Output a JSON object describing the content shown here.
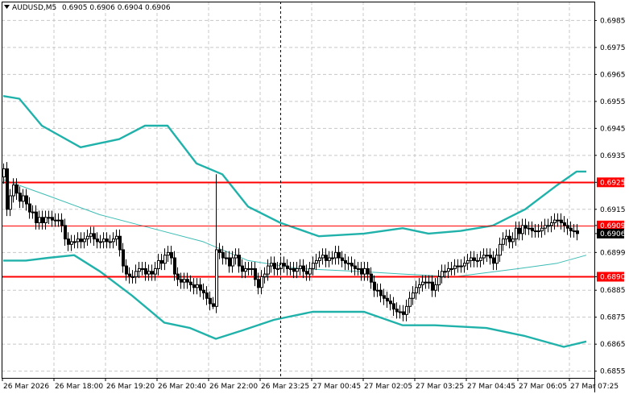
{
  "header": {
    "symbol": "AUDUSD,M5",
    "ohlc": "0.6905 0.6906 0.6904 0.6906",
    "dropdown_icon": "triangle-down-icon"
  },
  "colors": {
    "background": "#ffffff",
    "grid": "#c8c8c8",
    "candle": "#000000",
    "bands": "#20b2aa",
    "middle_band": "#3cbcb4",
    "level_line": "#ff0000",
    "level_label_bg": "#ff0000",
    "current_label_bg": "#000000",
    "current_label_text": "#ffffff"
  },
  "chart_data": {
    "type": "candlestick",
    "symbol": "AUDUSD",
    "timeframe": "M5",
    "ylim": [
      0.68525,
      0.6992
    ],
    "y_ticks": [
      "0.6985",
      "0.6975",
      "0.6965",
      "0.6955",
      "0.6945",
      "0.6935",
      "0.6925",
      "0.6915",
      "0.6909",
      "0.6906",
      "0.6899",
      "0.6890",
      "0.6885",
      "0.6875",
      "0.6865",
      "0.6855"
    ],
    "x_labels": [
      "26 Mar 2026",
      "26 Mar 18:00",
      "26 Mar 19:20",
      "26 Mar 20:40",
      "26 Mar 22:00",
      "26 Mar 23:25",
      "27 Mar 00:45",
      "27 Mar 02:05",
      "27 Mar 03:25",
      "27 Mar 04:45",
      "27 Mar 06:05",
      "27 Mar 07:25"
    ],
    "bars_per_label": 16,
    "cursor_bar_index": 86,
    "grid": true,
    "levels": [
      {
        "price": 0.6925,
        "label": "0.6925",
        "style": "thick"
      },
      {
        "price": 0.6909,
        "label": "0.6909",
        "style": "thin"
      },
      {
        "price": 0.689,
        "label": "0.6890",
        "style": "thick"
      }
    ],
    "current_price": {
      "price": 0.6906,
      "label": "0.6906"
    },
    "closes": [
      0.693,
      0.6915,
      0.692,
      0.6924,
      0.6921,
      0.6918,
      0.692,
      0.6917,
      0.6914,
      0.6914,
      0.691,
      0.6912,
      0.691,
      0.6912,
      0.6912,
      0.6911,
      0.6911,
      0.6911,
      0.6909,
      0.6904,
      0.6902,
      0.6903,
      0.6903,
      0.6904,
      0.6903,
      0.6904,
      0.6905,
      0.6906,
      0.6904,
      0.6903,
      0.6903,
      0.6904,
      0.6903,
      0.6903,
      0.6904,
      0.6905,
      0.69,
      0.6894,
      0.6891,
      0.689,
      0.689,
      0.6892,
      0.6893,
      0.6893,
      0.6891,
      0.6892,
      0.6891,
      0.6893,
      0.6896,
      0.6895,
      0.6898,
      0.6899,
      0.6897,
      0.6891,
      0.6889,
      0.6888,
      0.6889,
      0.6888,
      0.6887,
      0.6886,
      0.6887,
      0.6885,
      0.6884,
      0.6882,
      0.688,
      0.6879,
      0.69,
      0.6899,
      0.6897,
      0.6897,
      0.6894,
      0.6897,
      0.6898,
      0.6894,
      0.6892,
      0.6893,
      0.6893,
      0.6893,
      0.6889,
      0.6886,
      0.689,
      0.6891,
      0.6894,
      0.6895,
      0.6893,
      0.6893,
      0.6895,
      0.6894,
      0.6893,
      0.6893,
      0.6892,
      0.6893,
      0.6894,
      0.6892,
      0.6891,
      0.6893,
      0.6895,
      0.6896,
      0.6897,
      0.6898,
      0.6896,
      0.6897,
      0.6897,
      0.6899,
      0.6897,
      0.6896,
      0.6895,
      0.6895,
      0.6894,
      0.6893,
      0.6893,
      0.6891,
      0.6893,
      0.6891,
      0.6888,
      0.6885,
      0.6885,
      0.6883,
      0.6882,
      0.6881,
      0.688,
      0.6878,
      0.6877,
      0.6877,
      0.6876,
      0.6879,
      0.6882,
      0.6884,
      0.6886,
      0.6887,
      0.6888,
      0.6888,
      0.6888,
      0.6885,
      0.6887,
      0.689,
      0.6892,
      0.6892,
      0.6893,
      0.6893,
      0.6894,
      0.6894,
      0.6894,
      0.6895,
      0.6896,
      0.6897,
      0.6896,
      0.6896,
      0.6897,
      0.6898,
      0.6898,
      0.6897,
      0.6895,
      0.6898,
      0.6902,
      0.6904,
      0.6905,
      0.6903,
      0.6904,
      0.6908,
      0.6906,
      0.6909,
      0.6908,
      0.6908,
      0.6907,
      0.6907,
      0.6907,
      0.6908,
      0.6909,
      0.6909,
      0.691,
      0.6911,
      0.6911,
      0.691,
      0.6909,
      0.6908,
      0.6907,
      0.6907,
      0.6906
    ],
    "bands": {
      "upper": [
        [
          0,
          0.6957
        ],
        [
          5,
          0.6956
        ],
        [
          12,
          0.6946
        ],
        [
          24,
          0.6938
        ],
        [
          36,
          0.6941
        ],
        [
          44,
          0.6946
        ],
        [
          51,
          0.6946
        ],
        [
          60,
          0.6932
        ],
        [
          68,
          0.6928
        ],
        [
          76,
          0.6916
        ],
        [
          86,
          0.691
        ],
        [
          98,
          0.6905
        ],
        [
          112,
          0.6906
        ],
        [
          124,
          0.6908
        ],
        [
          132,
          0.6906
        ],
        [
          142,
          0.6907
        ],
        [
          152,
          0.6909
        ],
        [
          162,
          0.6915
        ],
        [
          172,
          0.6924
        ],
        [
          178,
          0.6929
        ],
        [
          181,
          0.6929
        ]
      ],
      "middle": [
        [
          0,
          0.6926
        ],
        [
          14,
          0.692
        ],
        [
          30,
          0.6913
        ],
        [
          46,
          0.6908
        ],
        [
          62,
          0.6903
        ],
        [
          76,
          0.6896
        ],
        [
          92,
          0.6893
        ],
        [
          110,
          0.6892
        ],
        [
          124,
          0.6891
        ],
        [
          140,
          0.689
        ],
        [
          160,
          0.6893
        ],
        [
          172,
          0.6895
        ],
        [
          181,
          0.6898
        ]
      ],
      "lower": [
        [
          0,
          0.6896
        ],
        [
          7,
          0.6896
        ],
        [
          14,
          0.6897
        ],
        [
          22,
          0.6898
        ],
        [
          30,
          0.6892
        ],
        [
          40,
          0.6883
        ],
        [
          50,
          0.6873
        ],
        [
          58,
          0.6871
        ],
        [
          66,
          0.6867
        ],
        [
          74,
          0.687
        ],
        [
          84,
          0.6874
        ],
        [
          96,
          0.6877
        ],
        [
          112,
          0.6877
        ],
        [
          124,
          0.6872
        ],
        [
          134,
          0.6872
        ],
        [
          150,
          0.6871
        ],
        [
          162,
          0.6868
        ],
        [
          174,
          0.6864
        ],
        [
          181,
          0.6866
        ]
      ]
    }
  }
}
